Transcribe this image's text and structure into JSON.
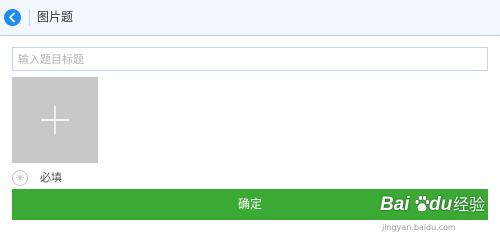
{
  "header": {
    "title": "图片题",
    "back_icon": "chevron-left-icon"
  },
  "question": {
    "title_value": "",
    "title_placeholder": "输入题目标题"
  },
  "image_upload": {
    "icon": "plus-icon"
  },
  "required": {
    "icon": "asterisk-icon",
    "label": "必填",
    "checked": false
  },
  "confirm_button": {
    "label": "确定"
  },
  "watermark": {
    "brand_left": "Bai",
    "brand_right": "du",
    "brand_suffix": "经验",
    "url": "jingyan.baidu.com"
  },
  "colors": {
    "accent_blue": "#1e8bf0",
    "confirm_green": "#3aaa35",
    "header_bg": "#f2f7fd",
    "upload_bg": "#c8c8c8"
  }
}
